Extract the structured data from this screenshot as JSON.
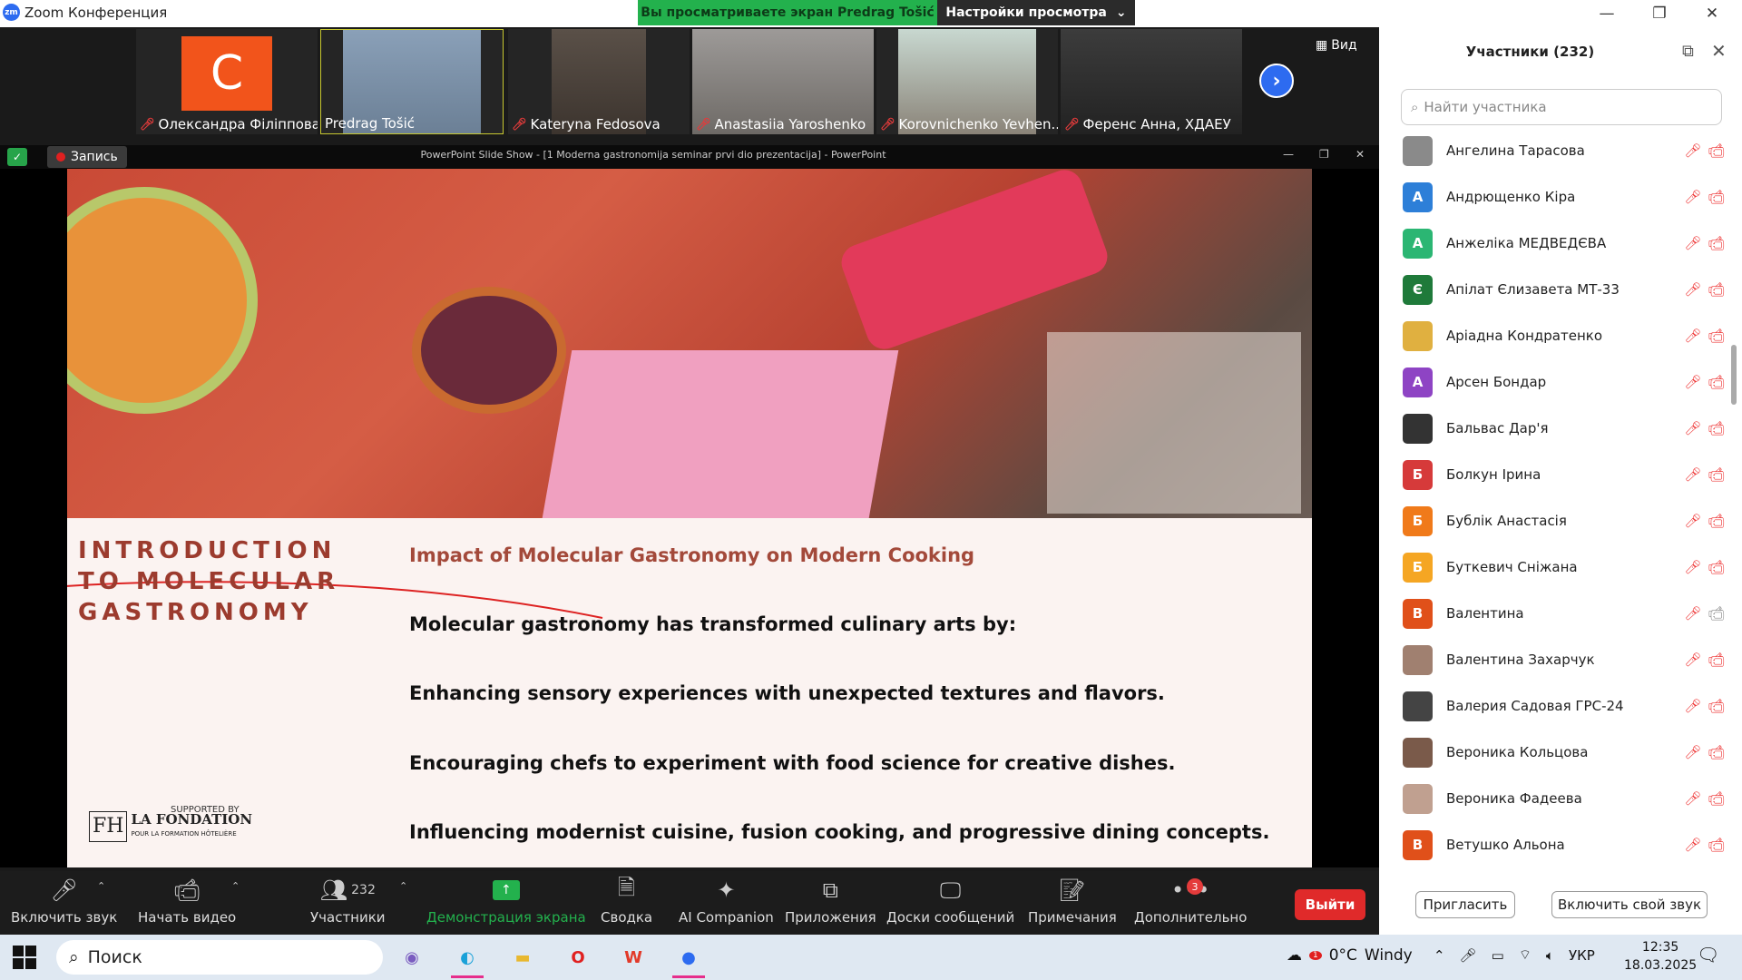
{
  "titlebar": {
    "app_title": "Zoom Конференция",
    "logo_text": "zm",
    "minimize": "—",
    "maximize": "❐",
    "close": "✕"
  },
  "banner": {
    "viewing": "Вы просматриваете экран Predrag Tošić",
    "settings": "Настройки просмотра",
    "settings_caret": "⌄"
  },
  "videos": [
    {
      "name": "Олександра Філіппова",
      "muted": true,
      "initial": "C",
      "color": "#f2541b"
    },
    {
      "name": "Predrag Tošić",
      "muted": false
    },
    {
      "name": "Kateryna Fedosova",
      "muted": true
    },
    {
      "name": "Anastasiia Yaroshenko",
      "muted": true
    },
    {
      "name": "Korovnichenko Yevhen...",
      "muted": true
    },
    {
      "name": "Ференс Анна, ХДАЕУ",
      "muted": true
    }
  ],
  "view_button": {
    "label": "Вид",
    "icon": "grid-icon"
  },
  "recording": {
    "label": "Запись"
  },
  "ppt": {
    "title": "PowerPoint Slide Show - [1 Moderna gastronomija seminar prvi dio prezentacija] - PowerPoint",
    "minimize": "—",
    "restore": "❐",
    "close": "✕"
  },
  "slide": {
    "left_title": "INTRODUCTION TO MOLECULAR GASTRONOMY",
    "subtitle": "Impact of Molecular Gastronomy on Modern Cooking",
    "bullets": [
      "Molecular gastronomy has transformed culinary arts by:",
      "Enhancing sensory experiences with unexpected textures and flavors.",
      "Encouraging chefs to experiment with food science for creative dishes.",
      "Influencing modernist cuisine, fusion cooking, and progressive dining concepts."
    ],
    "supported_by": "SUPPORTED BY",
    "logo_mark": "FH",
    "logo_name": "LA FONDATION",
    "logo_sub": "POUR LA FORMATION HÔTELIÈRE"
  },
  "toolbar": {
    "mute": "Включить звук",
    "video": "Начать видео",
    "participants": "Участники",
    "participants_count": "232",
    "share": "Демонстрация экрана",
    "summary": "Сводка",
    "ai": "AI Companion",
    "apps": "Приложения",
    "whiteboards": "Доски сообщений",
    "notes": "Примечания",
    "more": "Дополнительно",
    "more_badge": "3",
    "leave": "Выйти"
  },
  "panel": {
    "title": "Участники (232)",
    "search_placeholder": "Найти участника",
    "invite": "Пригласить",
    "unmute": "Включить свой звук",
    "participants": [
      {
        "name": "Ангелина Тарасова",
        "initial": "",
        "color": "#8a8a8a",
        "cam": false
      },
      {
        "name": "Андрющенко Кіра",
        "initial": "А",
        "color": "#2d7fd8",
        "cam": false
      },
      {
        "name": "Анжеліка МЕДВЕДЄВА",
        "initial": "А",
        "color": "#2bb673",
        "cam": false
      },
      {
        "name": "Апілат Єлизавета МТ-33",
        "initial": "Є",
        "color": "#1f7a3a",
        "cam": false
      },
      {
        "name": "Аріадна Кондратенко",
        "initial": "",
        "color": "#e0b040",
        "cam": false
      },
      {
        "name": "Арсен Бондар",
        "initial": "А",
        "color": "#8e44c4",
        "cam": false
      },
      {
        "name": "Бальвас Дар'я",
        "initial": "",
        "color": "#333333",
        "cam": false
      },
      {
        "name": "Болкун Ірина",
        "initial": "Б",
        "color": "#d63a3a",
        "cam": false
      },
      {
        "name": "Бублік Анастасія",
        "initial": "Б",
        "color": "#f07a1a",
        "cam": false
      },
      {
        "name": "Буткевич Сніжана",
        "initial": "Б",
        "color": "#f5a623",
        "cam": false
      },
      {
        "name": "Валентина",
        "initial": "В",
        "color": "#e0501a",
        "cam": true
      },
      {
        "name": "Валентина Захарчук",
        "initial": "",
        "color": "#a08070",
        "cam": false
      },
      {
        "name": "Валерия Садовая ГРС-24",
        "initial": "",
        "color": "#444444",
        "cam": false
      },
      {
        "name": "Вероника Кольцова",
        "initial": "",
        "color": "#7a5a4a",
        "cam": false
      },
      {
        "name": "Вероника Фадеева",
        "initial": "",
        "color": "#c0a090",
        "cam": false
      },
      {
        "name": "Ветушко Альона",
        "initial": "В",
        "color": "#e0501a",
        "cam": false
      }
    ]
  },
  "taskbar": {
    "search": "Поиск",
    "weather_temp": "0°C",
    "weather_label": "Windy",
    "lang": "УКР",
    "time": "12:35",
    "date": "18.03.2025",
    "notif_count": "3",
    "weather_badge": "1"
  }
}
